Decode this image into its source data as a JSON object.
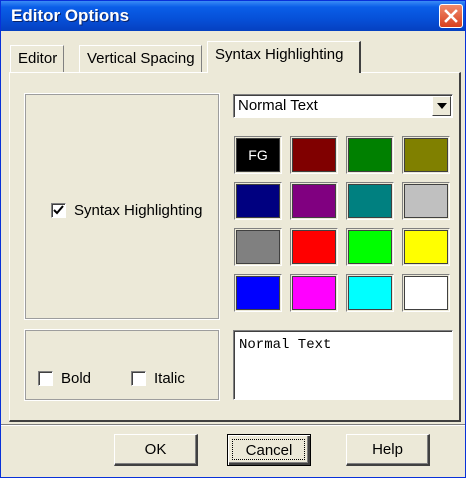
{
  "window": {
    "title": "Editor Options",
    "close_icon": "close-icon"
  },
  "tabs": [
    {
      "label": "Editor",
      "active": false
    },
    {
      "label": "Vertical Spacing",
      "active": false
    },
    {
      "label": "Syntax Highlighting",
      "active": true
    }
  ],
  "syntax": {
    "checkbox_label": "Syntax Highlighting",
    "checked": true
  },
  "element_select": {
    "value": "Normal Text"
  },
  "palette": {
    "fg_label": "FG",
    "colors": [
      "#000000",
      "#800000",
      "#008000",
      "#808000",
      "#000080",
      "#800080",
      "#008080",
      "#c0c0c0",
      "#808080",
      "#ff0000",
      "#00ff00",
      "#ffff00",
      "#0000ff",
      "#ff00ff",
      "#00ffff",
      "#ffffff"
    ]
  },
  "style": {
    "bold_label": "Bold",
    "bold_checked": false,
    "italic_label": "Italic",
    "italic_checked": false
  },
  "preview": {
    "text": "Normal Text"
  },
  "buttons": {
    "ok": "OK",
    "cancel": "Cancel",
    "help": "Help"
  }
}
